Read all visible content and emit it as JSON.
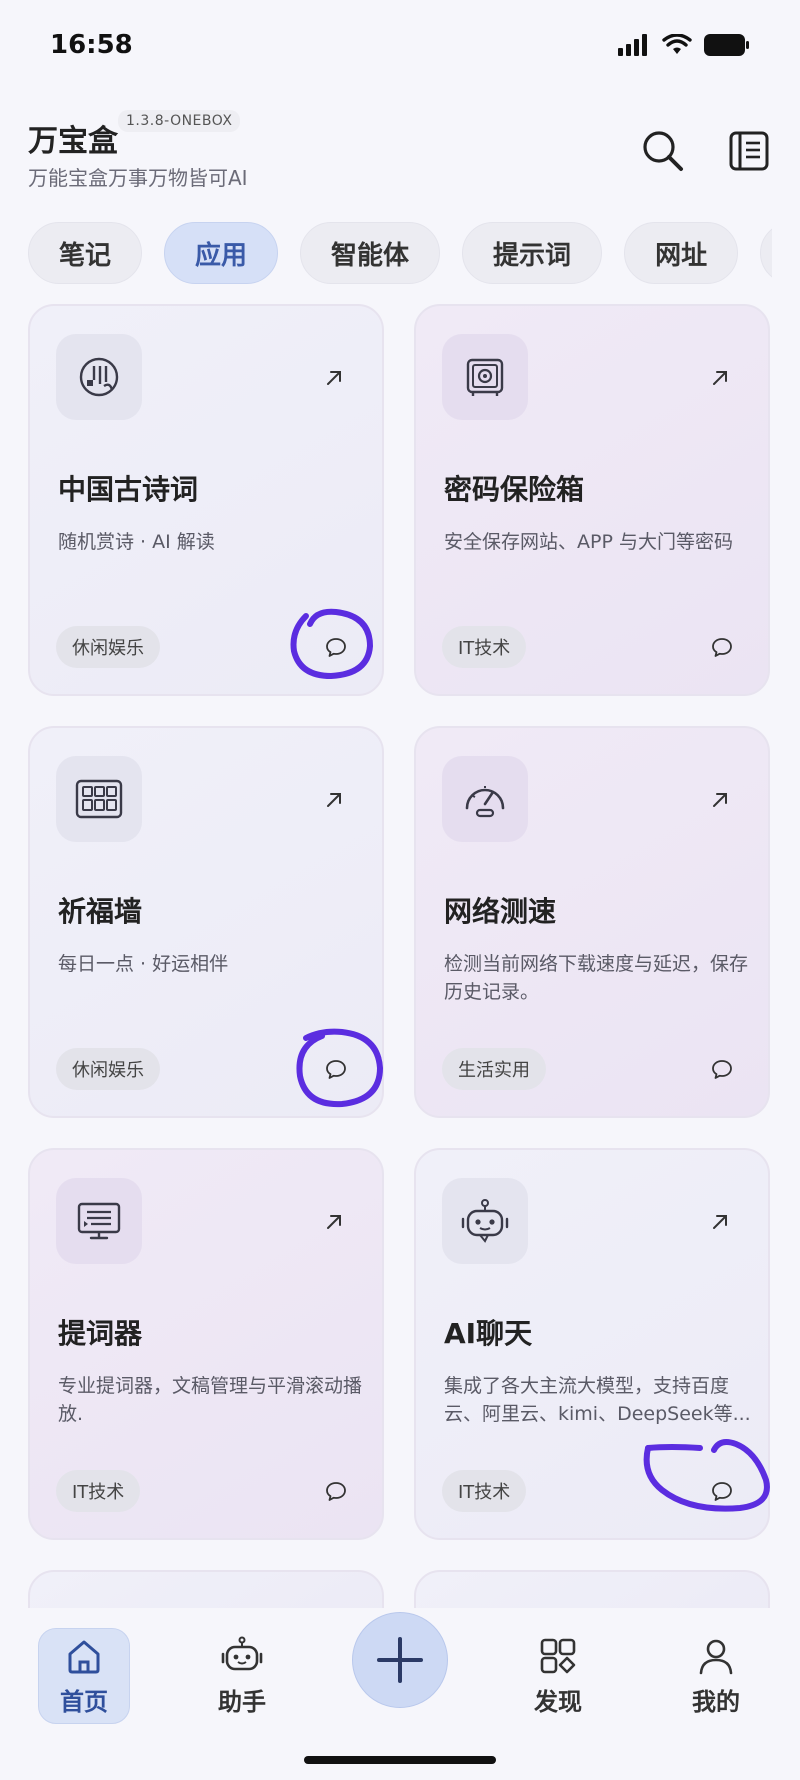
{
  "status_bar": {
    "time": "16:58"
  },
  "header": {
    "title": "万宝盒",
    "version": "1.3.8-ONEBOX",
    "subtitle": "万能宝盒万事万物皆可AI"
  },
  "tabs": [
    {
      "label": "笔记"
    },
    {
      "label": "应用"
    },
    {
      "label": "智能体"
    },
    {
      "label": "提示词"
    },
    {
      "label": "网址"
    }
  ],
  "active_tab": "应用",
  "cards": [
    {
      "title": "中国古诗词",
      "desc": "随机赏诗 · AI 解读",
      "tag": "休闲娱乐",
      "icon": "poetry-icon"
    },
    {
      "title": "密码保险箱",
      "desc": "安全保存网站、APP 与大门等密码",
      "tag": "IT技术",
      "icon": "safe-icon"
    },
    {
      "title": "祈福墙",
      "desc": "每日一点 · 好运相伴",
      "tag": "休闲娱乐",
      "icon": "wall-icon"
    },
    {
      "title": "网络测速",
      "desc": "检测当前网络下载速度与延迟，保存历史记录。",
      "tag": "生活实用",
      "icon": "speedometer-icon"
    },
    {
      "title": "提词器",
      "desc": "专业提词器，文稿管理与平滑滚动播放.",
      "tag": "IT技术",
      "icon": "teleprompter-icon"
    },
    {
      "title": "AI聊天",
      "desc": "集成了各大主流大模型，支持百度云、阿里云、kimi、DeepSeek等...",
      "tag": "IT技术",
      "icon": "robot-icon"
    }
  ],
  "bottom_nav": [
    {
      "label": "首页",
      "icon": "home-icon"
    },
    {
      "label": "助手",
      "icon": "robot-icon"
    },
    {
      "label": "",
      "icon": "plus-icon"
    },
    {
      "label": "发现",
      "icon": "grid-icon"
    },
    {
      "label": "我的",
      "icon": "user-icon"
    }
  ],
  "colors": {
    "accent": "#3a5aa8",
    "annotation": "#5b2de0",
    "card_blue": "#eeeef8",
    "card_purple": "#eee7f5"
  }
}
